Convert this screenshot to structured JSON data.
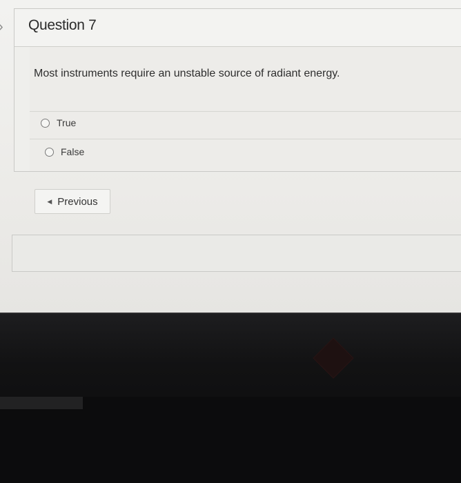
{
  "question": {
    "title": "Question 7",
    "text": "Most instruments require an unstable source of radiant energy.",
    "answers": [
      {
        "label": "True",
        "selected": false
      },
      {
        "label": "False",
        "selected": false
      }
    ]
  },
  "navigation": {
    "previous_label": "Previous",
    "previous_icon": "caret-left-icon"
  },
  "colors": {
    "page_background": "#ecebe8",
    "border": "#c9c9c6",
    "bezel": "#121213"
  }
}
